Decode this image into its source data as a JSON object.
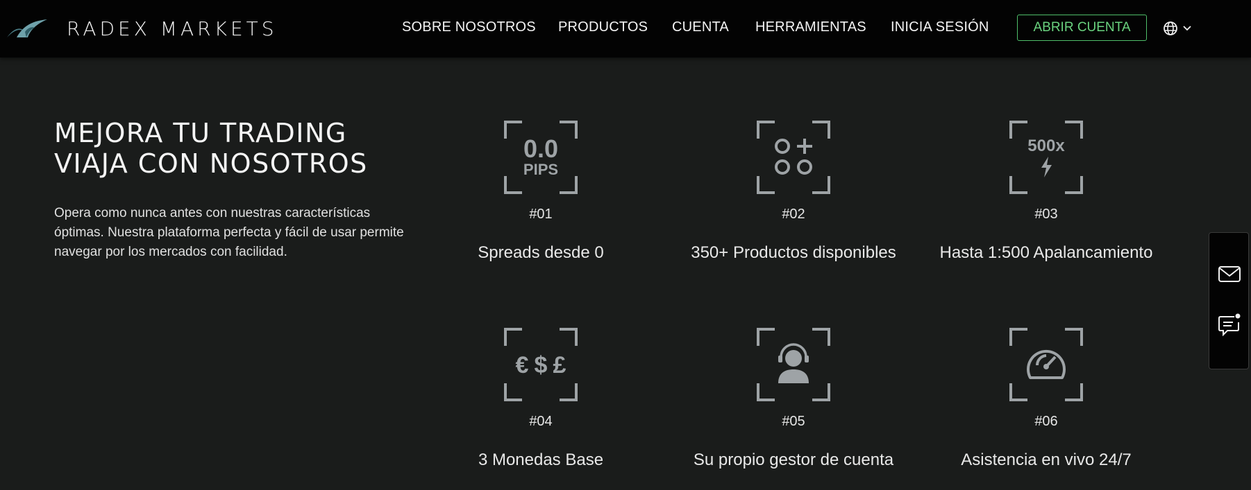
{
  "brand": {
    "name": "RADEX MARKETS"
  },
  "nav": {
    "items": [
      {
        "label": "SOBRE NOSOTROS"
      },
      {
        "label": "PRODUCTOS"
      },
      {
        "label": "CUENTA"
      },
      {
        "label": "HERRAMIENTAS"
      },
      {
        "label": "INICIA SESIÓN"
      }
    ],
    "cta_label": "ABRIR CUENTA",
    "language_icon": "globe-icon",
    "dropdown_icon": "chevron-down-icon"
  },
  "hero": {
    "title_line1": "MEJORA TU TRADING",
    "title_line2": "VIAJA CON NOSOTROS",
    "text": "Opera como nunca antes con nuestras características óptimas. Nuestra plataforma perfecta y fácil de usar permite navegar por los mercados con facilidad."
  },
  "features": [
    {
      "num": "#01",
      "label": "Spreads desde 0",
      "icon": "pips-icon",
      "icon_text_1": "0.0",
      "icon_text_2": "PIPS"
    },
    {
      "num": "#02",
      "label": "350+ Productos disponibles",
      "icon": "products-icon"
    },
    {
      "num": "#03",
      "label": "Hasta 1:500 Apalancamiento",
      "icon": "leverage-icon",
      "icon_text_1": "500x"
    },
    {
      "num": "#04",
      "label": "3 Monedas Base",
      "icon": "currencies-icon",
      "icon_text_1": "€",
      "icon_text_2": "$",
      "icon_text_3": "£"
    },
    {
      "num": "#05",
      "label": "Su propio gestor de cuenta",
      "icon": "account-manager-icon"
    },
    {
      "num": "#06",
      "label": "Asistencia en vivo 24/7",
      "icon": "speedometer-icon"
    }
  ],
  "side_panel": {
    "items": [
      "mail-icon",
      "chat-icon"
    ]
  },
  "colors": {
    "background": "#1a1c1b",
    "navbar": "#030303",
    "accent": "#6ad37f",
    "icon": "#9ea3a6"
  }
}
